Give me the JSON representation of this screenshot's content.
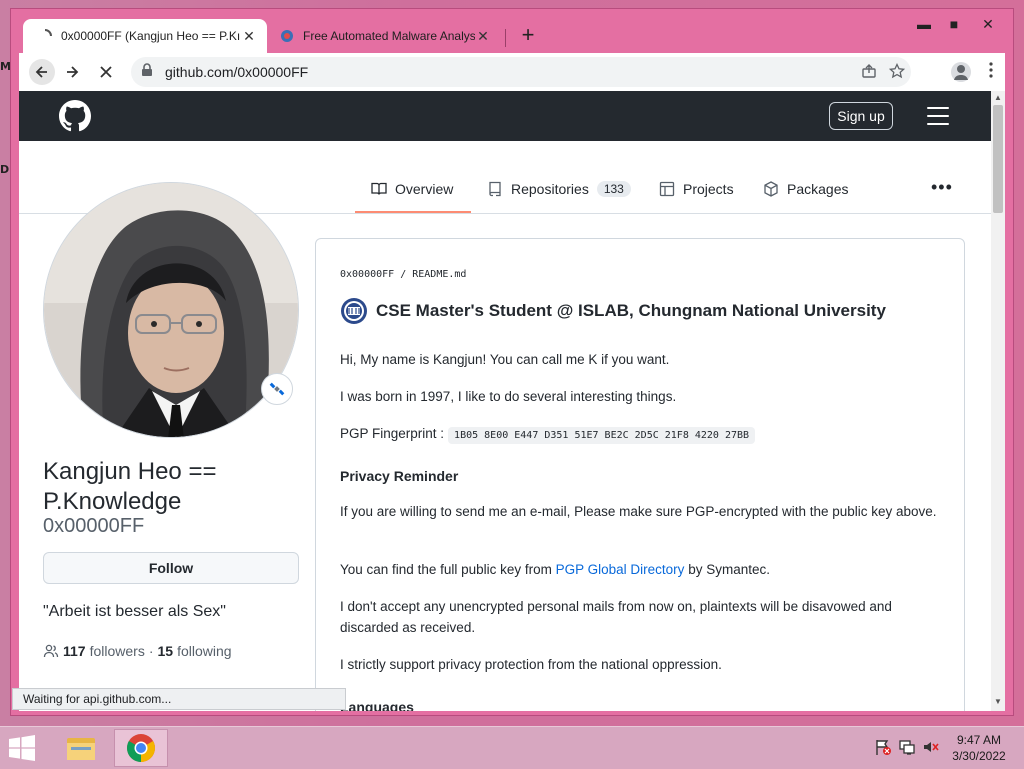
{
  "browser": {
    "tabs": [
      {
        "title": "0x00000FF (Kangjun Heo == P.Kı",
        "close": "✕",
        "active": true
      },
      {
        "title": "Free Automated Malware Analys",
        "close": "✕",
        "active": false
      }
    ],
    "new_tab": "+",
    "window_controls": {
      "minimize": "▬",
      "maximize": "■",
      "close": "✕"
    },
    "url": "github.com/0x00000FF",
    "status_text": "Waiting for api.github.com..."
  },
  "github": {
    "header": {
      "signup": "Sign up"
    },
    "nav": {
      "tabs": [
        {
          "label": "Overview",
          "selected": true
        },
        {
          "label": "Repositories",
          "count": "133"
        },
        {
          "label": "Projects"
        },
        {
          "label": "Packages"
        }
      ],
      "more": "•••"
    },
    "profile": {
      "name": "Kangjun Heo == P.Knowledge",
      "login": "0x00000FF",
      "follow_label": "Follow",
      "bio": "\"Arbeit ist besser als Sex\"",
      "followers_count": "117",
      "followers_label": "followers",
      "separator": "·",
      "following_count": "15",
      "following_label": "following"
    },
    "readme": {
      "breadcrumb": "0x00000FF / README.md",
      "heading": "CSE Master's Student @ ISLAB, Chungnam National University",
      "p1": "Hi, My name is Kangjun! You can call me K if you want.",
      "p2": "I was born in 1997, I like to do several interesting things.",
      "pgp_label": "PGP Fingerprint :",
      "pgp_value": "1B05 8E00 E447 D351 51E7 BE2C 2D5C 21F8 4220 27BB",
      "privacy_heading": "Privacy Reminder",
      "p3": "If you are willing to send me an e-mail, Please make sure PGP-encrypted with the public key above.",
      "p4_pre": "You can find the full public key from ",
      "p4_link": "PGP Global Directory",
      "p4_post": " by Symantec.",
      "p5": "I don't accept any unencrypted personal mails from now on, plaintexts will be disavowed and discarded as received.",
      "p6": "I strictly support privacy protection from the national oppression.",
      "languages_heading": "Languages"
    }
  },
  "taskbar": {
    "time": "9:47 AM",
    "date": "3/30/2022"
  },
  "colors": {
    "gh_header": "#24292f",
    "accent_underline": "#fd8c73",
    "link": "#0969da",
    "browser_frame": "#e46fa2"
  }
}
